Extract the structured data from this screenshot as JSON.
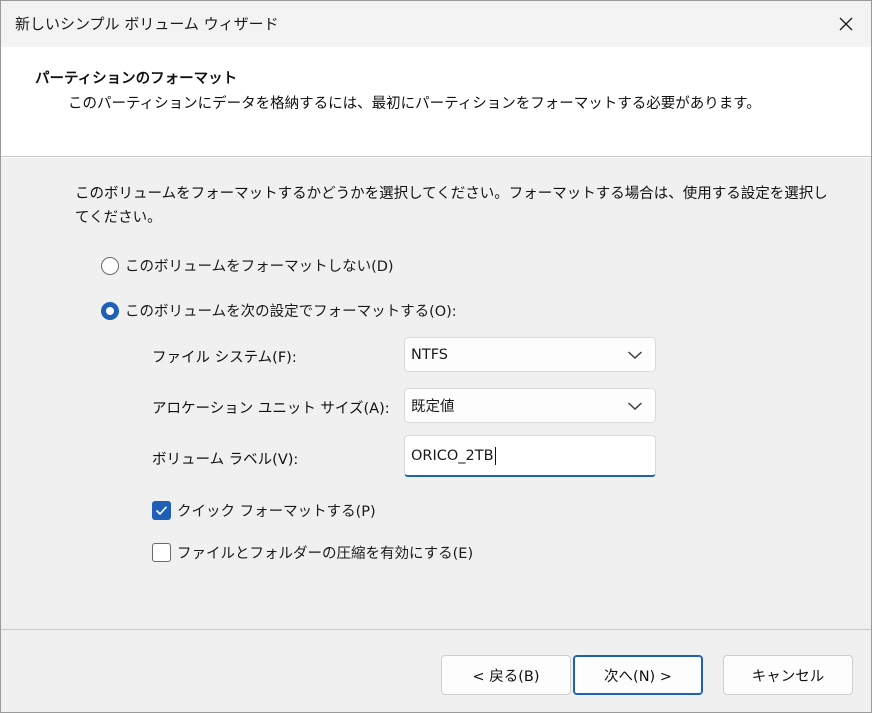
{
  "window": {
    "title": "新しいシンプル ボリューム ウィザード"
  },
  "header": {
    "title": "パーティションのフォーマット",
    "subtitle": "このパーティションにデータを格納するには、最初にパーティションをフォーマットする必要があります。"
  },
  "intro": "このボリュームをフォーマットするかどうかを選択してください。フォーマットする場合は、使用する設定を選択してください。",
  "options": {
    "no_format": {
      "label": "このボリュームをフォーマットしない(D)",
      "selected": false
    },
    "format": {
      "label": "このボリュームを次の設定でフォーマットする(O):",
      "selected": true
    }
  },
  "fields": {
    "file_system": {
      "label": "ファイル システム(F):",
      "value": "NTFS"
    },
    "allocation_unit": {
      "label": "アロケーション ユニット サイズ(A):",
      "value": "既定値"
    },
    "volume_label": {
      "label": "ボリューム ラベル(V):",
      "value": "ORICO_2TB"
    }
  },
  "checkboxes": {
    "quick_format": {
      "label": "クイック フォーマットする(P)",
      "checked": true
    },
    "compression": {
      "label": "ファイルとフォルダーの圧縮を有効にする(E)",
      "checked": false
    }
  },
  "buttons": {
    "back": "< 戻る(B)",
    "next": "次へ(N) >",
    "cancel": "キャンセル"
  },
  "colors": {
    "accent": "#1f5fb8"
  },
  "icons": {
    "close": "close-icon",
    "dropdown": "chevron-down-icon",
    "check": "checkmark-icon"
  }
}
